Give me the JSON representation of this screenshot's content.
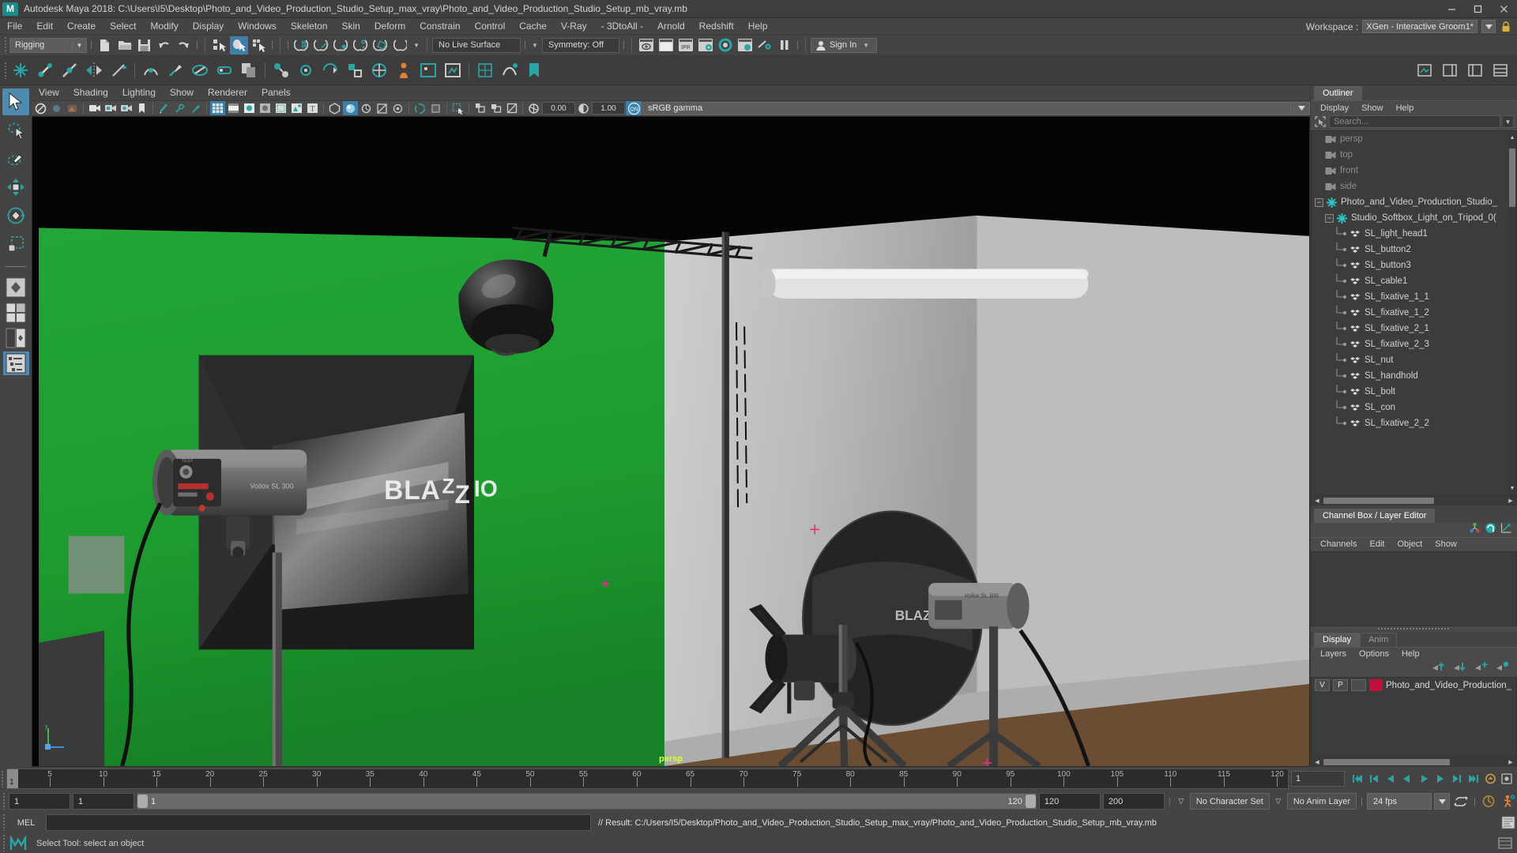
{
  "titlebar": {
    "app_icon": "maya-logo-icon",
    "title": "Autodesk Maya 2018: C:\\Users\\I5\\Desktop\\Photo_and_Video_Production_Studio_Setup_max_vray\\Photo_and_Video_Production_Studio_Setup_mb_vray.mb",
    "minimize": "—",
    "maximize": "☐",
    "close": "✕"
  },
  "menubar": {
    "items": [
      {
        "label": "File"
      },
      {
        "label": "Edit"
      },
      {
        "label": "Create"
      },
      {
        "label": "Select"
      },
      {
        "label": "Modify"
      },
      {
        "label": "Display"
      },
      {
        "label": "Windows"
      },
      {
        "label": "Skeleton"
      },
      {
        "label": "Skin"
      },
      {
        "label": "Deform"
      },
      {
        "label": "Constrain"
      },
      {
        "label": "Control"
      },
      {
        "label": "Cache"
      },
      {
        "label": "V-Ray"
      },
      {
        "label": "- 3DtoAll -"
      },
      {
        "label": "Arnold"
      },
      {
        "label": "Redshift"
      },
      {
        "label": "Help"
      }
    ],
    "workspace_label": "Workspace :",
    "workspace_value": "XGen - Interactive Groom1*"
  },
  "statusline": {
    "menu_set": "Rigging",
    "live_surface": "No Live Surface",
    "symmetry": "Symmetry: Off",
    "sign_in": "Sign In"
  },
  "toolbox": {
    "tools": [
      {
        "name": "select-tool",
        "selected": true
      },
      {
        "name": "lasso-select-tool",
        "selected": false
      },
      {
        "name": "paint-select-tool",
        "selected": false
      },
      {
        "name": "move-tool",
        "selected": false
      },
      {
        "name": "rotate-tool",
        "selected": false
      },
      {
        "name": "scale-tool",
        "selected": false
      }
    ]
  },
  "viewport": {
    "panel_menu": [
      "View",
      "Shading",
      "Lighting",
      "Show",
      "Renderer",
      "Panels"
    ],
    "exposure_value": "0.00",
    "gamma_value": "1.00",
    "color_space": "sRGB gamma",
    "camera_label": "persp"
  },
  "outliner": {
    "tab": "Outliner",
    "menu": [
      "Display",
      "Show",
      "Help"
    ],
    "search_placeholder": "Search...",
    "items": [
      {
        "label": "persp",
        "indent": 1,
        "icon": "camera-icon",
        "dim": true,
        "expander": false
      },
      {
        "label": "top",
        "indent": 1,
        "icon": "camera-icon",
        "dim": true,
        "expander": false
      },
      {
        "label": "front",
        "indent": 1,
        "icon": "camera-icon",
        "dim": true,
        "expander": false
      },
      {
        "label": "side",
        "indent": 1,
        "icon": "camera-icon",
        "dim": true,
        "expander": false
      },
      {
        "label": "Photo_and_Video_Production_Studio_",
        "indent": 0,
        "icon": "group-icon",
        "dim": false,
        "expander": true
      },
      {
        "label": "Studio_Softbox_Light_on_Tripod_0(",
        "indent": 1,
        "icon": "group-icon",
        "dim": false,
        "expander": true
      },
      {
        "label": "SL_light_head1",
        "indent": 2,
        "icon": "mesh-icon",
        "dim": false,
        "expander": false
      },
      {
        "label": "SL_button2",
        "indent": 2,
        "icon": "mesh-icon",
        "dim": false,
        "expander": false
      },
      {
        "label": "SL_button3",
        "indent": 2,
        "icon": "mesh-icon",
        "dim": false,
        "expander": false
      },
      {
        "label": "SL_cable1",
        "indent": 2,
        "icon": "mesh-icon",
        "dim": false,
        "expander": false
      },
      {
        "label": "SL_fixative_1_1",
        "indent": 2,
        "icon": "mesh-icon",
        "dim": false,
        "expander": false
      },
      {
        "label": "SL_fixative_1_2",
        "indent": 2,
        "icon": "mesh-icon",
        "dim": false,
        "expander": false
      },
      {
        "label": "SL_fixative_2_1",
        "indent": 2,
        "icon": "mesh-icon",
        "dim": false,
        "expander": false
      },
      {
        "label": "SL_fixative_2_3",
        "indent": 2,
        "icon": "mesh-icon",
        "dim": false,
        "expander": false
      },
      {
        "label": "SL_nut",
        "indent": 2,
        "icon": "mesh-icon",
        "dim": false,
        "expander": false
      },
      {
        "label": "SL_handhold",
        "indent": 2,
        "icon": "mesh-icon",
        "dim": false,
        "expander": false
      },
      {
        "label": "SL_bolt",
        "indent": 2,
        "icon": "mesh-icon",
        "dim": false,
        "expander": false
      },
      {
        "label": "SL_con",
        "indent": 2,
        "icon": "mesh-icon",
        "dim": false,
        "expander": false
      },
      {
        "label": "SL_fixative_2_2",
        "indent": 2,
        "icon": "mesh-icon",
        "dim": false,
        "expander": false
      }
    ]
  },
  "channelbox": {
    "tab": "Channel Box / Layer Editor",
    "menu": [
      "Channels",
      "Edit",
      "Object",
      "Show"
    ]
  },
  "layers": {
    "tabs": [
      {
        "label": "Display",
        "active": true
      },
      {
        "label": "Anim",
        "active": false
      }
    ],
    "menu": [
      "Layers",
      "Options",
      "Help"
    ],
    "rows": [
      {
        "v": "V",
        "p": "P",
        "third": "",
        "color": "#c2103c",
        "name": "Photo_and_Video_Production_"
      }
    ]
  },
  "timeslider": {
    "current_frame": "1",
    "ticks": [
      {
        "value": "5"
      },
      {
        "value": "10"
      },
      {
        "value": "15"
      },
      {
        "value": "20"
      },
      {
        "value": "25"
      },
      {
        "value": "30"
      },
      {
        "value": "35"
      },
      {
        "value": "40"
      },
      {
        "value": "45"
      },
      {
        "value": "50"
      },
      {
        "value": "55"
      },
      {
        "value": "60"
      },
      {
        "value": "65"
      },
      {
        "value": "70"
      },
      {
        "value": "75"
      },
      {
        "value": "80"
      },
      {
        "value": "85"
      },
      {
        "value": "90"
      },
      {
        "value": "95"
      },
      {
        "value": "100"
      },
      {
        "value": "105"
      },
      {
        "value": "110"
      },
      {
        "value": "115"
      },
      {
        "value": "120"
      }
    ],
    "frame_field": "1",
    "range_start_total": "1",
    "range_start": "1",
    "range_bar_start": "1",
    "range_bar_end": "120",
    "range_end": "120",
    "range_end_total": "200",
    "character_set": "No Character Set",
    "anim_layer": "No Anim Layer",
    "fps": "24 fps"
  },
  "commandline": {
    "mel_label": "MEL",
    "input_value": "",
    "output": "// Result: C:/Users/I5/Desktop/Photo_and_Video_Production_Studio_Setup_max_vray/Photo_and_Video_Production_Studio_Setup_mb_vray.mb"
  },
  "helpline": {
    "text": "Select Tool: select an object"
  },
  "colors": {
    "accent_blue": "#4e89ae",
    "teal": "#2aa5a5",
    "greenscreen": "#1e9e32",
    "layer_red": "#c2103c",
    "persp_yellow": "#d6ff3d"
  }
}
